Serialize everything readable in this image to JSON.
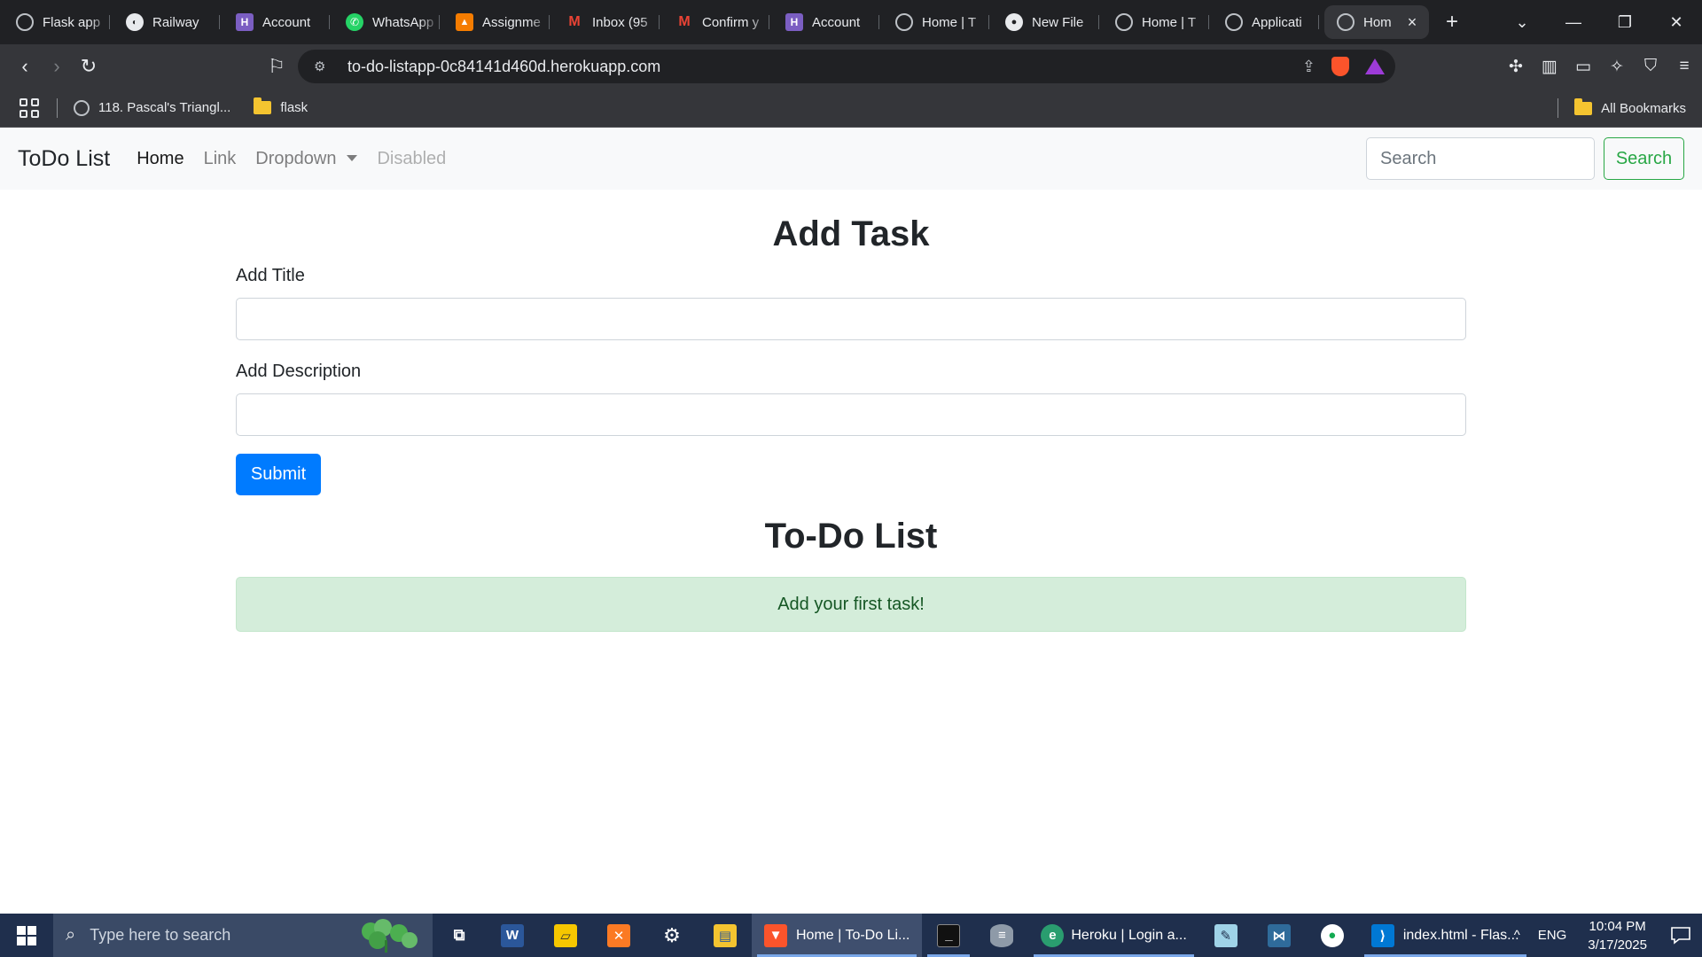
{
  "browser": {
    "tabs": [
      {
        "title": "Flask app",
        "icon": "openai-icon",
        "active": false
      },
      {
        "title": "Railway",
        "icon": "railway-icon",
        "active": false
      },
      {
        "title": "Account",
        "icon": "heroku-icon",
        "active": false
      },
      {
        "title": "WhatsApp",
        "icon": "whatsapp-icon",
        "active": false
      },
      {
        "title": "Assignme",
        "icon": "assignment-icon",
        "active": false
      },
      {
        "title": "Inbox (95",
        "icon": "gmail-icon",
        "active": false
      },
      {
        "title": "Confirm y",
        "icon": "gmail-icon",
        "active": false
      },
      {
        "title": "Account",
        "icon": "heroku-icon",
        "active": false
      },
      {
        "title": "Home | T",
        "icon": "globe-icon",
        "active": false
      },
      {
        "title": "New File",
        "icon": "github-icon",
        "active": false
      },
      {
        "title": "Home | T",
        "icon": "globe-icon",
        "active": false
      },
      {
        "title": "Applicati",
        "icon": "globe-icon",
        "active": false
      },
      {
        "title": "Hom",
        "icon": "globe-icon",
        "active": true
      }
    ],
    "url": "to-do-listapp-0c84141d460d.herokuapp.com",
    "bookmarks": [
      {
        "label": "118. Pascal's Triangl...",
        "icon": "globe-icon"
      },
      {
        "label": "flask",
        "icon": "folder-icon"
      }
    ],
    "all_bookmarks_label": "All Bookmarks"
  },
  "navbar": {
    "brand": "ToDo List",
    "links": {
      "home": "Home",
      "link": "Link",
      "dropdown": "Dropdown",
      "disabled": "Disabled"
    },
    "search_placeholder": "Search",
    "search_button": "Search"
  },
  "form": {
    "heading": "Add Task",
    "title_label": "Add Title",
    "title_value": "",
    "description_label": "Add Description",
    "description_value": "",
    "submit_label": "Submit"
  },
  "list": {
    "heading": "To-Do List",
    "empty_message": "Add your first task!"
  },
  "taskbar": {
    "search_placeholder": "Type here to search",
    "items": [
      {
        "label": "Home | To-Do Li...",
        "icon": "brave-icon"
      },
      {
        "label": "Heroku | Login a...",
        "icon": "edge-dev-icon"
      },
      {
        "label": "index.html - Flas...",
        "icon": "vscode-icon"
      }
    ],
    "language": "ENG",
    "time": "10:04 PM",
    "date": "3/17/2025"
  },
  "colors": {
    "primary": "#007bff",
    "success": "#28a745",
    "alert_bg": "#d4edda",
    "alert_text": "#155724",
    "browser_dark": "#202124",
    "taskbar": "#1f2f4d"
  }
}
